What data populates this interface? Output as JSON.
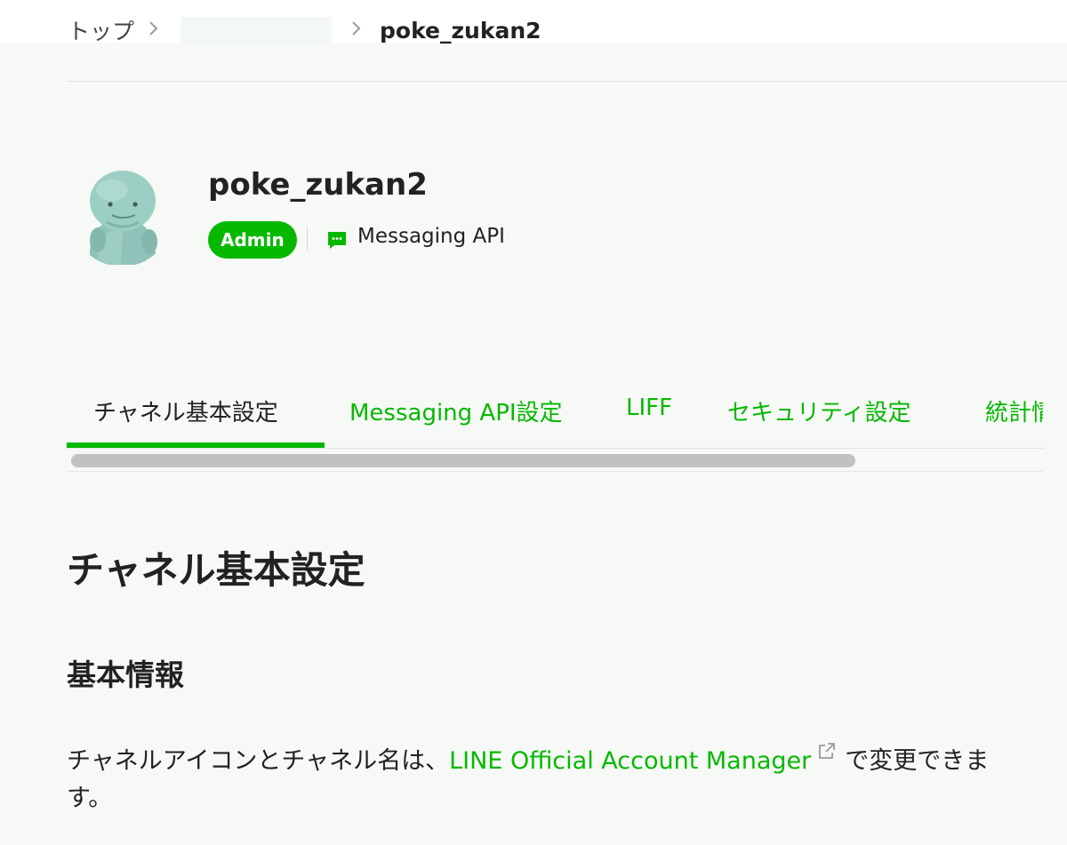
{
  "breadcrumb": {
    "top_label": "トップ",
    "current_label": "poke_zukan2"
  },
  "channel": {
    "name": "poke_zukan2",
    "role": "Admin",
    "type": "Messaging API"
  },
  "tabs": [
    {
      "label": "チャネル基本設定",
      "active": true
    },
    {
      "label": "Messaging API設定",
      "active": false
    },
    {
      "label": "LIFF",
      "active": false
    },
    {
      "label": "セキュリティ設定",
      "active": false
    },
    {
      "label": "統計情報",
      "active": false
    }
  ],
  "content": {
    "page_title": "チャネル基本設定",
    "section_title": "基本情報",
    "info_before": "チャネルアイコンとチャネル名は、",
    "info_link": "LINE Official Account Manager",
    "info_after": "で変更できます。"
  },
  "colors": {
    "accent": "#06b800",
    "background": "#f6f9f6",
    "text": "#222222"
  },
  "icons": {
    "breadcrumb_separator": "chevron-right-icon",
    "channel_type": "message-bubble-icon",
    "external_link": "external-link-icon"
  }
}
